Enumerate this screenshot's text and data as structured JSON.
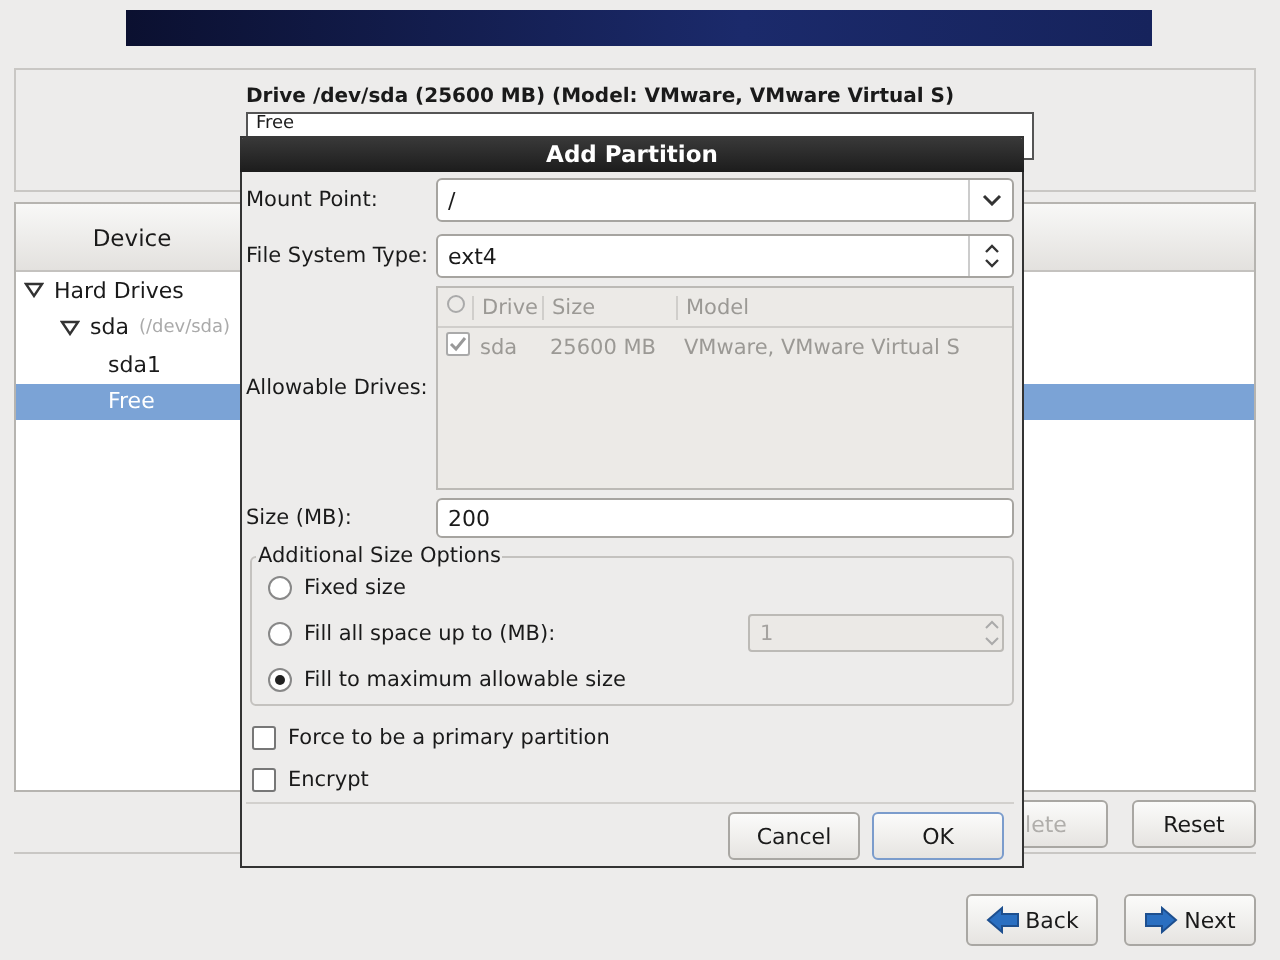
{
  "drive": {
    "title": "Drive /dev/sda (25600 MB) (Model: VMware, VMware Virtual S)",
    "bar_label": "Free"
  },
  "device_table": {
    "columns": [
      "Device"
    ],
    "tree": [
      {
        "label": "Hard Drives",
        "expanded": true,
        "selected": false,
        "children": [
          {
            "label": "sda",
            "sublabel": "(/dev/sda)",
            "expanded": true,
            "selected": false,
            "children": [
              {
                "label": "sda1",
                "selected": false
              },
              {
                "label": "Free",
                "selected": true
              }
            ]
          }
        ]
      }
    ]
  },
  "panel_buttons": [
    {
      "label": "lete",
      "disabled": true
    },
    {
      "label": "Reset",
      "disabled": false
    }
  ],
  "dialog": {
    "title": "Add Partition",
    "mount_point": {
      "label": "Mount Point:",
      "value": "/"
    },
    "fs_type": {
      "label": "File System Type:",
      "value": "ext4"
    },
    "allowable_drives": {
      "label": "Allowable Drives:",
      "disabled": true,
      "columns": [
        "Drive",
        "Size",
        "Model"
      ],
      "rows": [
        {
          "checked": true,
          "drive": "sda",
          "size": "25600 MB",
          "model": "VMware, VMware Virtual S"
        }
      ]
    },
    "size": {
      "label": "Size (MB):",
      "value": "200"
    },
    "size_options": {
      "title": "Additional Size Options",
      "options": [
        {
          "label": "Fixed size",
          "selected": false
        },
        {
          "label": "Fill all space up to (MB):",
          "selected": false,
          "spin_value": "1",
          "spin_disabled": true
        },
        {
          "label": "Fill to maximum allowable size",
          "selected": true
        }
      ]
    },
    "checkboxes": [
      {
        "label": "Force to be a primary partition",
        "checked": false
      },
      {
        "label": "Encrypt",
        "checked": false
      }
    ],
    "buttons": [
      {
        "label": "Cancel",
        "default": false
      },
      {
        "label": "OK",
        "default": true
      }
    ]
  },
  "nav_buttons": [
    {
      "label": "Back",
      "kind": "back"
    },
    {
      "label": "Next",
      "kind": "next"
    }
  ]
}
